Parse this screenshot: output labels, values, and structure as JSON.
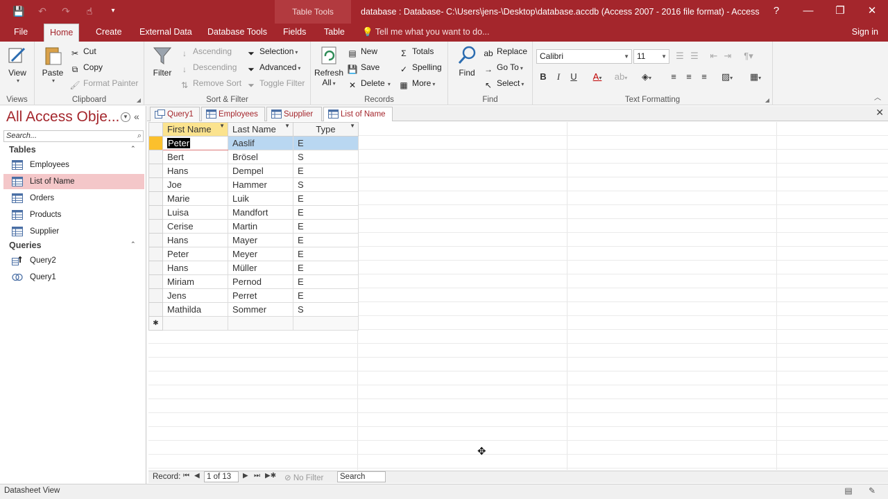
{
  "titlebar": {
    "contextual_group": "Table Tools",
    "title": "database : Database- C:\\Users\\jens-\\Desktop\\database.accdb (Access 2007 - 2016 file format) - Access",
    "help_icon": "?",
    "minimize_icon": "—",
    "restore_icon": "❐",
    "close_icon": "✕",
    "qat_icons": [
      "save-icon",
      "undo-icon",
      "redo-icon",
      "touch-mode-icon",
      "customize-qat-icon"
    ]
  },
  "ribbon_tabs": {
    "file": "File",
    "home": "Home",
    "create": "Create",
    "external_data": "External Data",
    "database_tools": "Database Tools",
    "fields": "Fields",
    "table": "Table",
    "tell_me": "Tell me what you want to do...",
    "sign_in": "Sign in"
  },
  "ribbon": {
    "views": {
      "view": "View",
      "label": "Views"
    },
    "clipboard": {
      "paste": "Paste",
      "cut": "Cut",
      "copy": "Copy",
      "format_painter": "Format Painter",
      "label": "Clipboard"
    },
    "sort_filter": {
      "filter": "Filter",
      "ascending": "Ascending",
      "descending": "Descending",
      "remove_sort": "Remove Sort",
      "selection": "Selection",
      "advanced": "Advanced",
      "toggle_filter": "Toggle Filter",
      "label": "Sort & Filter"
    },
    "records": {
      "refresh": "Refresh",
      "refresh_all": "All",
      "new": "New",
      "save": "Save",
      "delete": "Delete",
      "totals": "Totals",
      "spelling": "Spelling",
      "more": "More",
      "label": "Records"
    },
    "find": {
      "find": "Find",
      "replace": "Replace",
      "goto": "Go To",
      "select": "Select",
      "label": "Find"
    },
    "text_formatting": {
      "font": "Calibri",
      "size": "11",
      "label": "Text Formatting"
    }
  },
  "nav": {
    "title": "All Access Obje...",
    "search_placeholder": "Search...",
    "tables_header": "Tables",
    "tables": [
      "Employees",
      "List of Name",
      "Orders",
      "Products",
      "Supplier"
    ],
    "queries_header": "Queries",
    "queries": [
      "Query2",
      "Query1"
    ]
  },
  "doc_tabs": [
    "Query1",
    "Employees",
    "Supplier",
    "List of Name"
  ],
  "datasheet": {
    "columns": [
      "First Name",
      "Last Name",
      "Type"
    ],
    "rows": [
      [
        "Peter",
        "Aaslif",
        "E"
      ],
      [
        "Bert",
        "Brösel",
        "S"
      ],
      [
        "Hans",
        "Dempel",
        "E"
      ],
      [
        "Joe",
        "Hammer",
        "S"
      ],
      [
        "Marie",
        "Luik",
        "E"
      ],
      [
        "Luisa",
        "Mandfort",
        "E"
      ],
      [
        "Cerise",
        "Martin",
        "E"
      ],
      [
        "Hans",
        "Mayer",
        "E"
      ],
      [
        "Peter",
        "Meyer",
        "E"
      ],
      [
        "Hans",
        "Müller",
        "E"
      ],
      [
        "Miriam",
        "Pernod",
        "E"
      ],
      [
        "Jens",
        "Perret",
        "E"
      ],
      [
        "Mathilda",
        "Sommer",
        "S"
      ]
    ],
    "new_row_marker": "✱"
  },
  "record_nav": {
    "label": "Record:",
    "position": "1 of 13",
    "filter": "No Filter",
    "search": "Search"
  },
  "status": {
    "text": "Datasheet View"
  },
  "colors": {
    "accent": "#a4262c",
    "selection_row": "#b9d7f1",
    "selected_column": "#fbe38e",
    "selected_nav": "#f4c7c9"
  }
}
